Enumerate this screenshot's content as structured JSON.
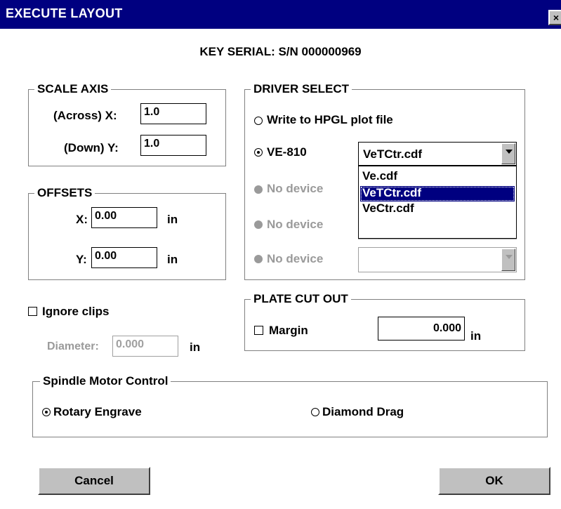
{
  "window": {
    "title": "EXECUTE LAYOUT",
    "close_label": "×"
  },
  "serial": "KEY SERIAL: S/N 000000969",
  "scale_axis": {
    "legend": "SCALE AXIS",
    "x_label": "(Across) X:",
    "x_value": "1.0",
    "y_label": "(Down) Y:",
    "y_value": "1.0"
  },
  "offsets": {
    "legend": "OFFSETS",
    "x_label": "X:",
    "x_value": "0.00",
    "x_unit": "in",
    "y_label": "Y:",
    "y_value": "0.00",
    "y_unit": "in"
  },
  "ignore_clips": {
    "label": "Ignore clips",
    "checked": false,
    "diameter_label": "Diameter:",
    "diameter_value": "0.000",
    "diameter_unit": "in"
  },
  "driver_select": {
    "legend": "DRIVER SELECT",
    "write_hpgl_label": "Write to HPGL plot file",
    "ve810_label": "VE-810",
    "ve810_value": "VeTCtr.cdf",
    "no_device_label": "No device",
    "dropdown_options": [
      "Ve.cdf",
      "VeTCtr.cdf",
      "VeCtr.cdf"
    ],
    "selected_option": "VeTCtr.cdf"
  },
  "plate_cut_out": {
    "legend": "PLATE CUT OUT",
    "margin_label": "Margin",
    "margin_checked": false,
    "margin_value": "0.000",
    "margin_unit": "in"
  },
  "spindle_motor": {
    "legend": "Spindle Motor Control",
    "rotary_label": "Rotary Engrave",
    "diamond_label": "Diamond Drag",
    "selected": "Rotary Engrave"
  },
  "buttons": {
    "cancel": "Cancel",
    "ok": "OK"
  }
}
